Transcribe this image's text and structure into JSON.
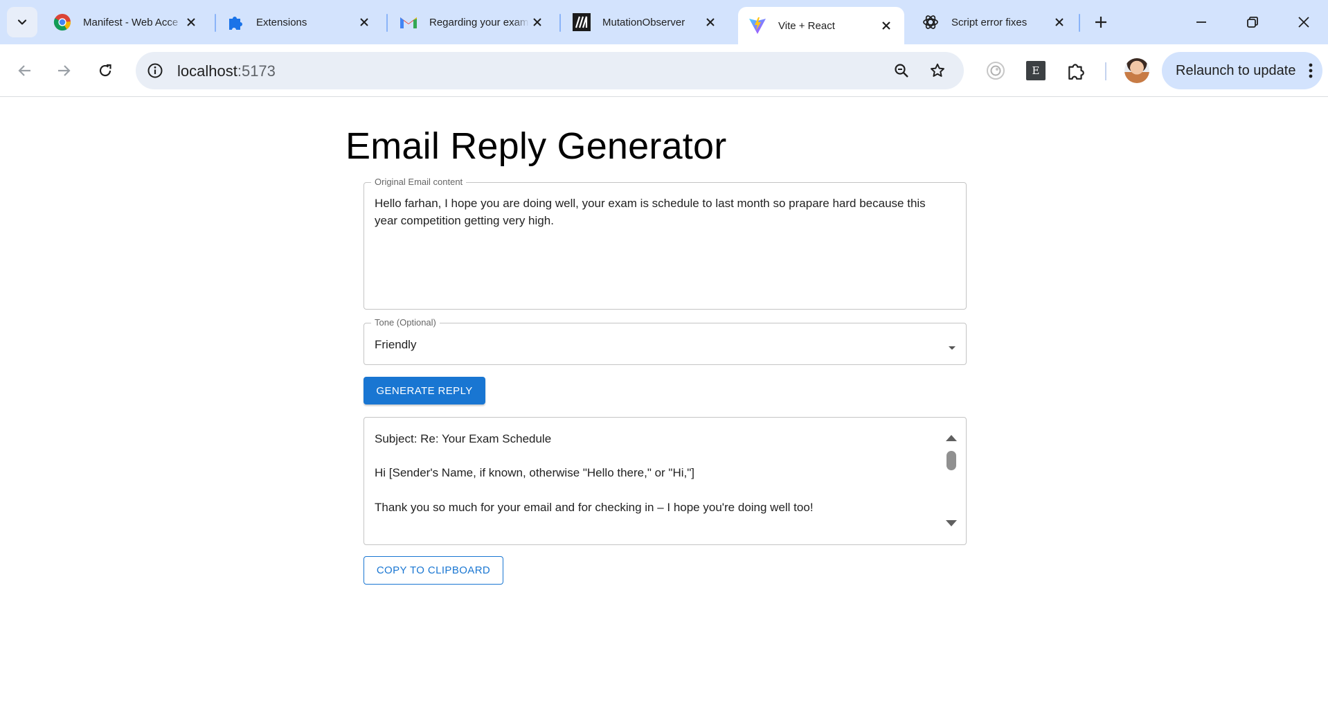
{
  "browser": {
    "tabs": [
      {
        "title": "Manifest - Web Acce",
        "favicon": "chrome-icon"
      },
      {
        "title": "Extensions",
        "favicon": "puzzle-icon"
      },
      {
        "title": "Regarding your exam",
        "favicon": "gmail-icon"
      },
      {
        "title": "MutationObserver",
        "favicon": "mdn-icon"
      },
      {
        "title": "Vite + React",
        "favicon": "vite-icon",
        "active": true
      },
      {
        "title": "Script error fixes",
        "favicon": "openai-icon"
      }
    ],
    "url_host": "localhost",
    "url_port": ":5173",
    "relaunch_label": "Relaunch to update",
    "extension_badge": "E"
  },
  "app": {
    "title": "Email Reply Generator",
    "original_email": {
      "label": "Original Email content",
      "value_line1": "Hello farhan, I hope you are doing well, your exam is schedule to last month so prapare hard because this",
      "value_line2": "year competition getting very high."
    },
    "tone": {
      "label": "Tone (Optional)",
      "selected": "Friendly"
    },
    "generate_label": "GENERATE REPLY",
    "reply_lines": [
      "Subject: Re: Your Exam Schedule",
      "Hi [Sender's Name, if known, otherwise \"Hello there,\" or \"Hi,\"]",
      "Thank you so much for your email and for checking in – I hope you're doing well too!"
    ],
    "copy_label": "COPY TO CLIPBOARD"
  },
  "colors": {
    "primary": "#1976d2",
    "tabstrip": "#d3e3fd",
    "omnibox": "#e9eef6"
  }
}
